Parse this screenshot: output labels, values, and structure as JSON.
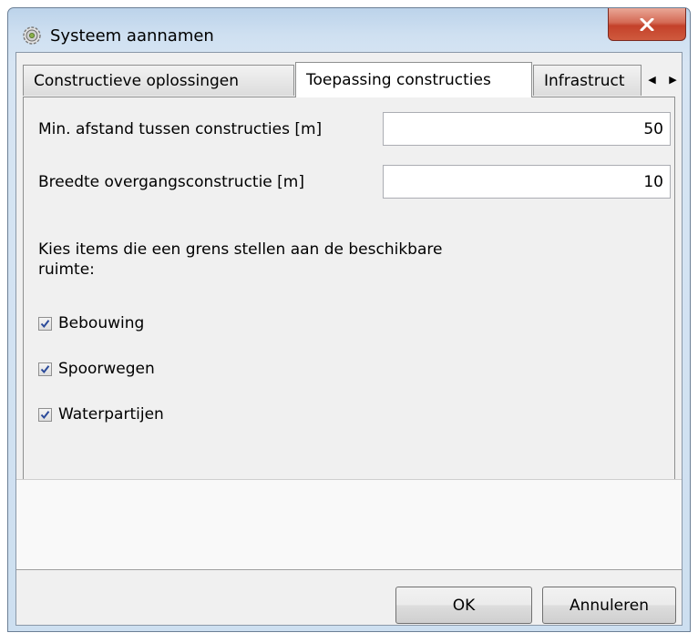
{
  "window": {
    "title": "Systeem aannamen",
    "close_glyph": "X"
  },
  "tabs": [
    {
      "label": "Constructieve oplossingen",
      "active": false
    },
    {
      "label": "Toepassing constructies",
      "active": true
    },
    {
      "label": "Infrastruct",
      "active": false
    }
  ],
  "tab_scroll": {
    "left": "◀",
    "right": "▶"
  },
  "fields": [
    {
      "label": "Min. afstand tussen constructies [m]",
      "value": "50"
    },
    {
      "label": "Breedte overgangsconstructie [m]",
      "value": "10"
    }
  ],
  "description": "Kies items die een grens stellen aan de beschikbare ruimte:",
  "checkboxes": [
    {
      "label": "Bebouwing",
      "checked": true
    },
    {
      "label": "Spoorwegen",
      "checked": true
    },
    {
      "label": "Waterpartijen",
      "checked": true
    }
  ],
  "buttons": {
    "ok": "OK",
    "cancel": "Annuleren"
  },
  "icons": {
    "app": "gear-icon",
    "close": "close-icon",
    "check": "checkmark-icon"
  }
}
